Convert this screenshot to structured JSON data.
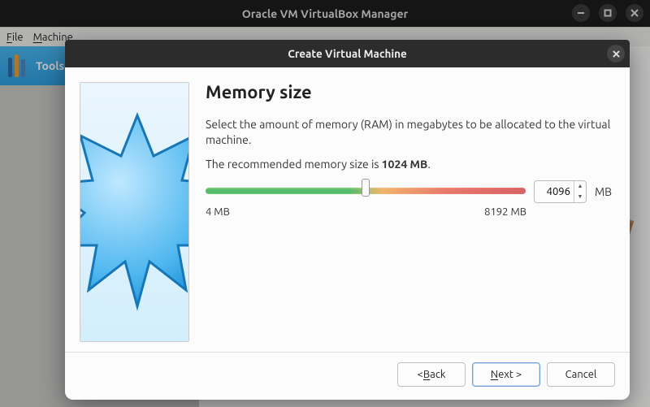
{
  "window": {
    "title": "Oracle VM VirtualBox Manager"
  },
  "menu": {
    "file": "File",
    "machine": "Machine"
  },
  "sidebar": {
    "tools_label": "Tools"
  },
  "dialog": {
    "title": "Create Virtual Machine",
    "heading": "Memory size",
    "description": "Select the amount of memory (RAM) in megabytes to be allocated to the virtual machine.",
    "recommended_prefix": "The recommended memory size is ",
    "recommended_value": "1024 MB",
    "recommended_suffix": ".",
    "slider": {
      "min_label": "4 MB",
      "max_label": "8192 MB",
      "value": "4096",
      "unit": "MB"
    },
    "buttons": {
      "back": "< Back",
      "next": "Next >",
      "cancel": "Cancel"
    }
  }
}
